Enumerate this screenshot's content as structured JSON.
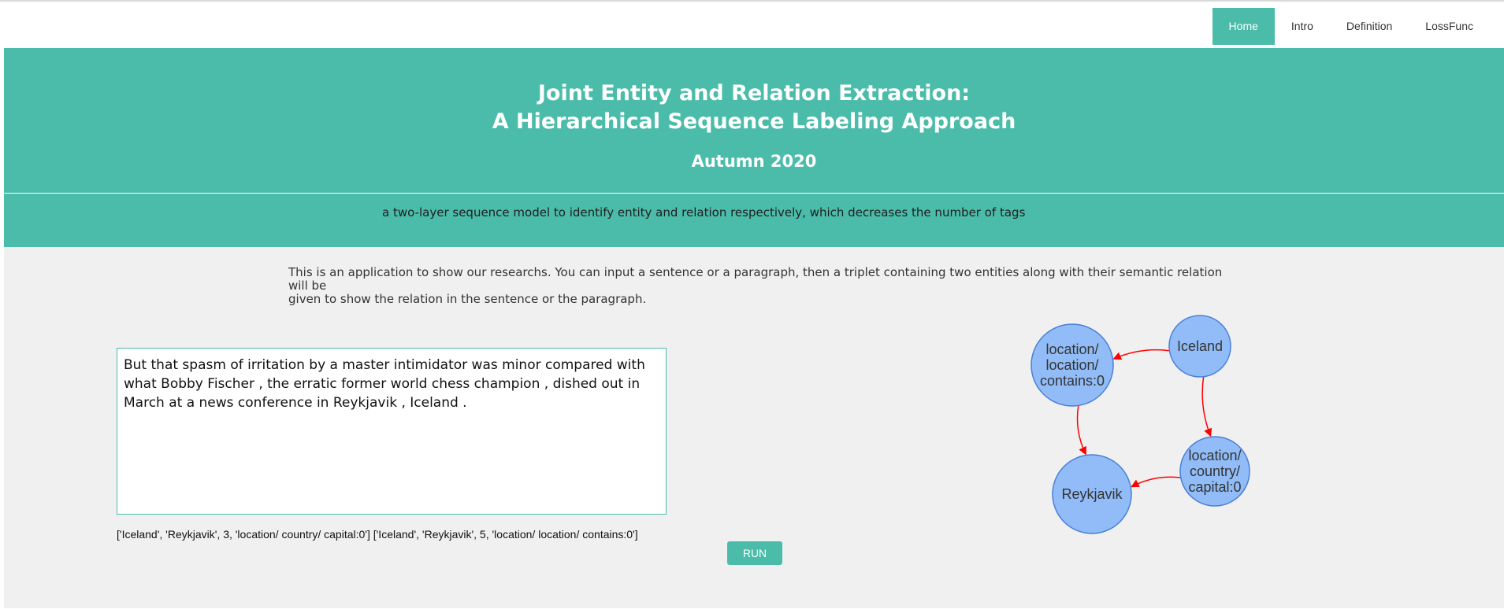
{
  "nav": {
    "items": [
      {
        "label": "Home",
        "active": true
      },
      {
        "label": "Intro",
        "active": false
      },
      {
        "label": "Definition",
        "active": false
      },
      {
        "label": "LossFunc",
        "active": false
      }
    ]
  },
  "hero": {
    "title_line1": "Joint Entity and Relation Extraction:",
    "title_line2": "A Hierarchical Sequence Labeling Approach",
    "subtitle": "Autumn 2020",
    "tagline": "a two-layer sequence model to identify entity and relation respectively, which decreases the number of tags"
  },
  "main": {
    "intro_line1": "This is an application to show our researchs. You can input a sentence or a paragraph, then a triplet containing two entities along with their semantic relation will be",
    "intro_line2": "given to show the relation in the sentence or the paragraph.",
    "sentence": "But that spasm of irritation by a master intimidator was minor compared with what Bobby Fischer , the erratic former world chess champion , dished out in March at a news conference in Reykjavik , Iceland .",
    "result": "['Iceland', 'Reykjavik', 3, 'location/ country/ capital:0'] ['Iceland', 'Reykjavik', 5, 'location/ location/ contains:0']",
    "run_label": "RUN"
  },
  "graph": {
    "nodes": [
      {
        "id": "iceland",
        "lines": [
          "Iceland"
        ]
      },
      {
        "id": "contains",
        "lines": [
          "location/",
          "location/",
          "contains:0"
        ]
      },
      {
        "id": "capital",
        "lines": [
          "location/",
          "country/",
          "capital:0"
        ]
      },
      {
        "id": "reykjavik",
        "lines": [
          "Reykjavik"
        ]
      }
    ],
    "edges": [
      {
        "from": "iceland",
        "to": "contains"
      },
      {
        "from": "iceland",
        "to": "capital"
      },
      {
        "from": "contains",
        "to": "reykjavik"
      },
      {
        "from": "capital",
        "to": "reykjavik"
      }
    ],
    "colors": {
      "node_fill": "#91bcf7",
      "node_stroke": "#4a7fd6",
      "edge": "#ff0000"
    }
  }
}
